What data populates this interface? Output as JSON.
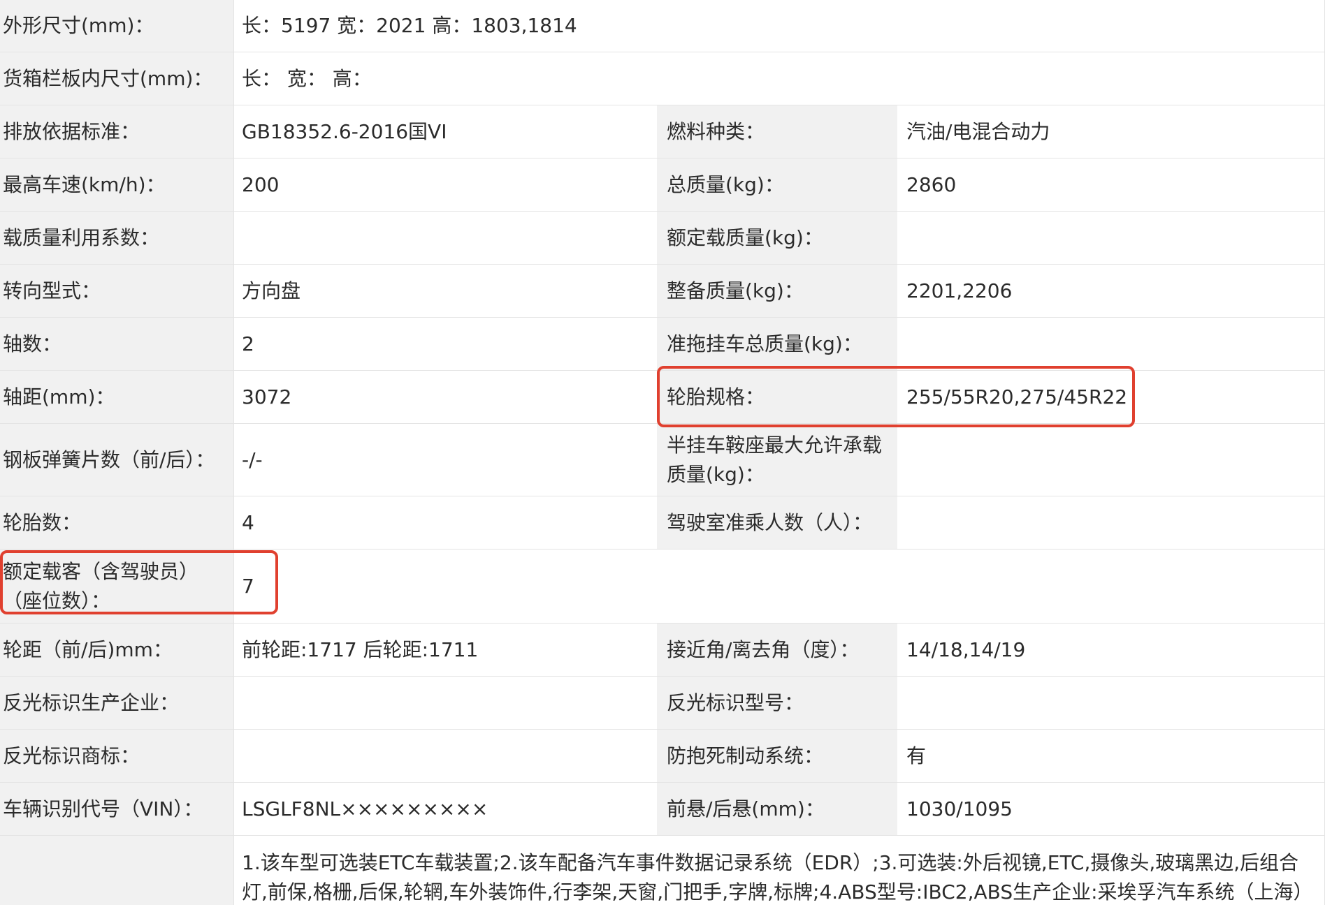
{
  "rows": [
    {
      "label": "外形尺寸(mm)：",
      "value": "长：5197 宽：2021 高：1803,1814"
    },
    {
      "label": "货箱栏板内尺寸(mm)：",
      "value": "长： 宽： 高："
    },
    {
      "label": "排放依据标准：",
      "value": "GB18352.6-2016国VI",
      "label2": "燃料种类：",
      "value2": "汽油/电混合动力"
    },
    {
      "label": "最高车速(km/h)：",
      "value": "200",
      "label2": "总质量(kg)：",
      "value2": "2860"
    },
    {
      "label": "载质量利用系数：",
      "value": "",
      "label2": "额定载质量(kg)：",
      "value2": ""
    },
    {
      "label": "转向型式：",
      "value": "方向盘",
      "label2": "整备质量(kg)：",
      "value2": "2201,2206"
    },
    {
      "label": "轴数：",
      "value": "2",
      "label2": "准拖挂车总质量(kg)：",
      "value2": ""
    },
    {
      "label": "轴距(mm)：",
      "value": "3072",
      "label2": "轮胎规格：",
      "value2": "255/55R20,275/45R22"
    },
    {
      "label": "钢板弹簧片数（前/后）：",
      "value": "-/-",
      "label2": "半挂车鞍座最大允许承载质量(kg)：",
      "value2": ""
    },
    {
      "label": "轮胎数：",
      "value": "4",
      "label2": "驾驶室准乘人数（人）：",
      "value2": ""
    },
    {
      "label": "额定载客（含驾驶员）（座位数）：",
      "value": "7"
    },
    {
      "label": "轮距（前/后)mm：",
      "value": "前轮距:1717 后轮距:1711",
      "label2": "接近角/离去角（度）：",
      "value2": "14/18,14/19"
    },
    {
      "label": "反光标识生产企业：",
      "value": "",
      "label2": "反光标识型号：",
      "value2": ""
    },
    {
      "label": "反光标识商标：",
      "value": "",
      "label2": "防抱死制动系统：",
      "value2": "有"
    },
    {
      "label": "车辆识别代号（VIN）：",
      "value": "LSGLF8NL×××××××××",
      "label2": "前悬/后悬(mm)：",
      "value2": "1030/1095"
    },
    {
      "label": "",
      "value": "1.该车型可选装ETC车载装置;2.该车配备汽车事件数据记录系统（EDR）;3.可选装:外后视镜,ETC,摄像头,玻璃黑边,后组合灯,前保,格栅,后保,轮辋,车外装饰件,行李架,天窗,门把手,字牌,标牌;4.ABS型号:IBC2,ABS生产企业:采埃孚汽车系统（上海）"
    }
  ],
  "highlight_color": "#e0402f"
}
